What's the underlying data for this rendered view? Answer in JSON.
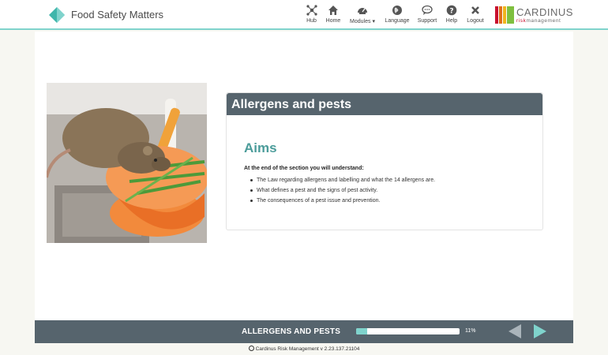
{
  "app": {
    "title": "Food Safety Matters",
    "brand_name": "CARDINUS",
    "brand_sub_a": "risk",
    "brand_sub_b": "management",
    "colors": {
      "teal": "#4b9c9a",
      "accent": "#7fd3cc",
      "bar": "#56646d"
    }
  },
  "nav": {
    "items": [
      {
        "label": "Hub",
        "icon": "hub-icon"
      },
      {
        "label": "Home",
        "icon": "home-icon"
      },
      {
        "label": "Modules",
        "icon": "modules-icon"
      },
      {
        "label": "Language",
        "icon": "globe-icon"
      },
      {
        "label": "Support",
        "icon": "chat-icon"
      },
      {
        "label": "Help",
        "icon": "help-icon"
      },
      {
        "label": "Logout",
        "icon": "close-icon"
      }
    ]
  },
  "card": {
    "header": "Allergens and pests",
    "heading": "Aims",
    "intro": "At the end of the section you will understand:",
    "bullets": [
      "The Law regarding allergens and labelling and what the 14 allergens are.",
      "What defines a pest and the signs of pest activity.",
      "The consequences of a pest issue and prevention."
    ]
  },
  "footer": {
    "section_title": "ALLERGENS AND PESTS",
    "progress_percent": 11,
    "progress_text": "11%",
    "prev_icon": "prev-arrow-icon",
    "next_icon": "next-arrow-icon"
  },
  "version": "Cardinus Risk Management v 2.23.137.21104"
}
